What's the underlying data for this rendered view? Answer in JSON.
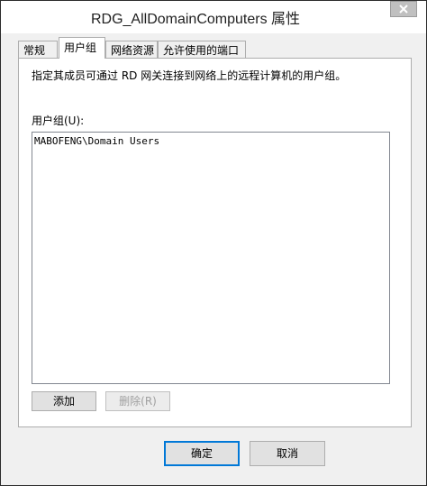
{
  "window": {
    "title": "RDG_AllDomainComputers 属性"
  },
  "tabs": [
    {
      "label": "常规"
    },
    {
      "label": "用户组"
    },
    {
      "label": "网络资源"
    },
    {
      "label": "允许使用的端口"
    }
  ],
  "panel": {
    "description": "指定其成员可通过 RD 网关连接到网络上的远程计算机的用户组。",
    "group_label": "用户组(U):",
    "groups": [
      "MABOFENG\\Domain Users"
    ],
    "add_label": "添加",
    "remove_label": "删除(R)"
  },
  "footer": {
    "ok_label": "确定",
    "cancel_label": "取消"
  },
  "icons": {
    "close": "close-icon"
  }
}
